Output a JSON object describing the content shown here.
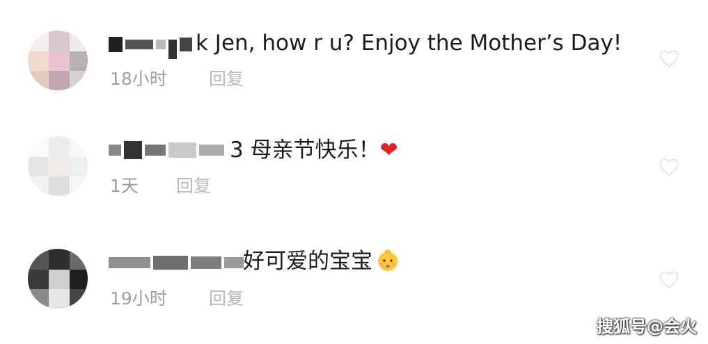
{
  "comments": [
    {
      "text": "k Jen, how r u? Enjoy the Mother’s Day!",
      "time": "18小时",
      "reply_label": "回复",
      "like_icon": "heart-outline-icon"
    },
    {
      "text": "3 母亲节快乐！",
      "emoji": "❤",
      "time": "1天",
      "reply_label": "回复",
      "like_icon": "heart-outline-icon"
    },
    {
      "text": "好可爱的宝宝",
      "emoji_icon": "baby-face-icon",
      "time": "19小时",
      "reply_label": "回复",
      "like_icon": "heart-outline-icon"
    }
  ],
  "watermark": "搜狐号@会火",
  "colors": {
    "text": "#1b1b1b",
    "meta": "#9e9e9e",
    "reply": "#b9b9b9",
    "heart": "#e0202b",
    "like_outline": "#e4e4e4"
  }
}
